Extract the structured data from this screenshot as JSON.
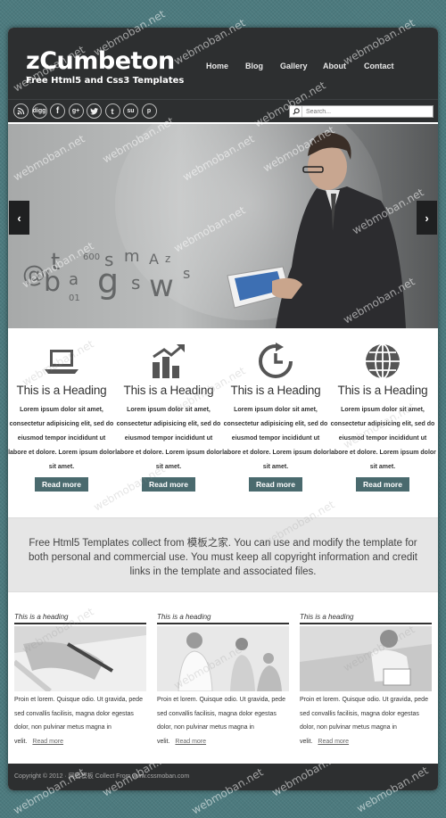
{
  "header": {
    "logo_title": "zCumbeton",
    "logo_subtitle": "Free Html5 and Css3 Templates",
    "nav": [
      "Home",
      "Blog",
      "Gallery",
      "About",
      "Contact"
    ],
    "social": [
      "rss",
      "digg",
      "f",
      "g+",
      "t",
      "t",
      "su",
      "p"
    ],
    "search_placeholder": "Search..."
  },
  "slider": {
    "prev": "‹",
    "next": "›"
  },
  "features": [
    {
      "icon": "laptop-icon",
      "heading": "This is a Heading",
      "text": "Lorem ipsum dolor sit amet, consectetur adipisicing elit, sed do eiusmod tempor incididunt ut labore et dolore. Lorem ipsum dolor sit amet.",
      "button": "Read more"
    },
    {
      "icon": "chart-icon",
      "heading": "This is a Heading",
      "text": "Lorem ipsum dolor sit amet, consectetur adipisicing elit, sed do eiusmod tempor incididunt ut labore et dolore. Lorem ipsum dolor sit amet.",
      "button": "Read more"
    },
    {
      "icon": "clock-refresh-icon",
      "heading": "This is a Heading",
      "text": "Lorem ipsum dolor sit amet, consectetur adipisicing elit, sed do eiusmod tempor incididunt ut labore et dolore. Lorem ipsum dolor sit amet.",
      "button": "Read more"
    },
    {
      "icon": "globe-icon",
      "heading": "This is a Heading",
      "text": "Lorem ipsum dolor sit amet, consectetur adipisicing elit, sed do eiusmod tempor incididunt ut labore et dolore. Lorem ipsum dolor sit amet.",
      "button": "Read more"
    }
  ],
  "band_text": "Free Html5 Templates collect from 模板之家. You can use and modify the template for both personal and commercial use. You must keep all copyright information and credit links in the template and associated files.",
  "posts": [
    {
      "heading": "This is a heading",
      "text": "Proin et lorem. Quisque odio. Ut gravida, pede sed convallis facilisis, magna dolor egestas dolor, non pulvinar metus magna in velit.",
      "link": "Read more"
    },
    {
      "heading": "This is a heading",
      "text": "Proin et lorem. Quisque odio. Ut gravida, pede sed convallis facilisis, magna dolor egestas dolor, non pulvinar metus magna in velit.",
      "link": "Read more"
    },
    {
      "heading": "This is a heading",
      "text": "Proin et lorem. Quisque odio. Ut gravida, pede sed convallis facilisis, magna dolor egestas dolor, non pulvinar metus magna in velit.",
      "link": "Read more"
    }
  ],
  "footer": "Copyright © 2012 · 网页模板 Collect From www.cssmoban.com",
  "watermark": "webmoban.net",
  "colors": {
    "header_bg": "#2d2f30",
    "button_bg": "#4a6a6e",
    "page_bg": "#4c7a7e",
    "band_bg": "#e6e6e6"
  }
}
